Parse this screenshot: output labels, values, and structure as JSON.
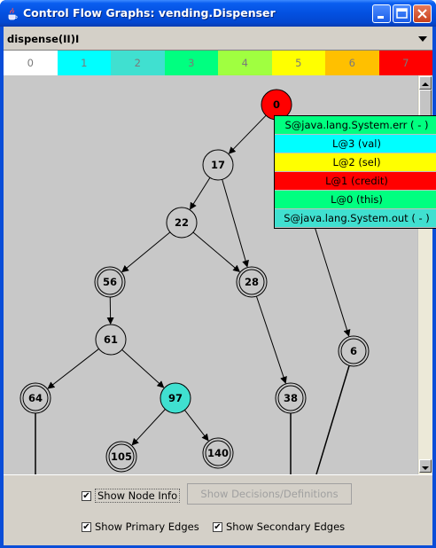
{
  "window": {
    "title": "Control Flow Graphs: vending.Dispenser"
  },
  "method_selector": {
    "selected": "dispense(II)I"
  },
  "palette": [
    {
      "label": "0",
      "color": "#ffffff"
    },
    {
      "label": "1",
      "color": "#00ffff"
    },
    {
      "label": "2",
      "color": "#40e0d0"
    },
    {
      "label": "3",
      "color": "#00ff80"
    },
    {
      "label": "4",
      "color": "#a0ff40"
    },
    {
      "label": "5",
      "color": "#ffff00"
    },
    {
      "label": "6",
      "color": "#ffc000"
    },
    {
      "label": "7",
      "color": "#ff0000"
    }
  ],
  "popup": [
    {
      "label": "S@java.lang.System.err ( - )",
      "color": "#00ff80"
    },
    {
      "label": "L@3 (val)",
      "color": "#00ffff"
    },
    {
      "label": "L@2 (sel)",
      "color": "#ffff00"
    },
    {
      "label": "L@1 (credit)",
      "color": "#ff0000"
    },
    {
      "label": "L@0 (this)",
      "color": "#00ff80"
    },
    {
      "label": "S@java.lang.System.out ( - )",
      "color": "#40e0d0"
    }
  ],
  "graph": {
    "nodes": [
      {
        "id": "0",
        "fill": "#ff0000"
      },
      {
        "id": "17",
        "fill": "#c8c8c8"
      },
      {
        "id": "22",
        "fill": "#c8c8c8"
      },
      {
        "id": "56",
        "fill": "#c8c8c8",
        "double": true
      },
      {
        "id": "28",
        "fill": "#c8c8c8",
        "double": true
      },
      {
        "id": "61",
        "fill": "#c8c8c8"
      },
      {
        "id": "6",
        "fill": "#c8c8c8",
        "double": true
      },
      {
        "id": "64",
        "fill": "#c8c8c8",
        "double": true
      },
      {
        "id": "97",
        "fill": "#40e0d0"
      },
      {
        "id": "38",
        "fill": "#c8c8c8",
        "double": true
      },
      {
        "id": "105",
        "fill": "#c8c8c8",
        "double": true
      },
      {
        "id": "140",
        "fill": "#c8c8c8",
        "double": true
      }
    ],
    "edges": [
      [
        "0",
        "17"
      ],
      [
        "17",
        "22"
      ],
      [
        "17",
        "28"
      ],
      [
        "22",
        "56"
      ],
      [
        "22",
        "28"
      ],
      [
        "56",
        "61"
      ],
      [
        "61",
        "64"
      ],
      [
        "61",
        "97"
      ],
      [
        "97",
        "105"
      ],
      [
        "97",
        "140"
      ],
      [
        "28",
        "38"
      ],
      [
        "0",
        "6"
      ]
    ]
  },
  "controls": {
    "show_node_info": {
      "label": "Show Node Info",
      "checked": true
    },
    "show_decisions": {
      "label": "Show Decisions/Definitions"
    },
    "show_primary_edges": {
      "label": "Show Primary Edges",
      "checked": true
    },
    "show_secondary_edges": {
      "label": "Show Secondary Edges",
      "checked": true
    }
  }
}
